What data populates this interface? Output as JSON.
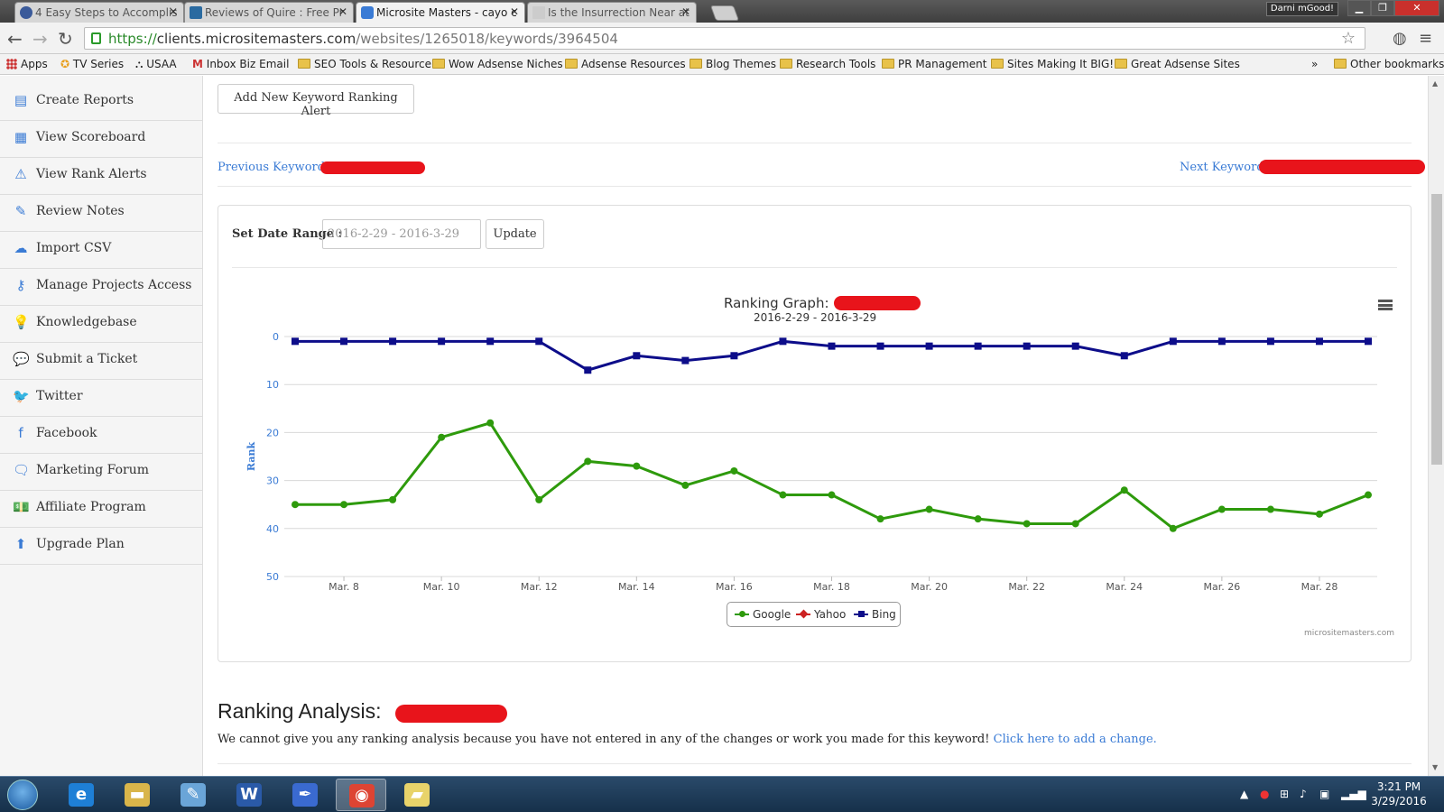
{
  "browser": {
    "tabs": [
      {
        "title": "4 Easy Steps to Accomplis",
        "active": false,
        "icon_color": "#3a5a9a"
      },
      {
        "title": "Reviews of Quire : Free Pr",
        "active": false,
        "icon_color": "#2a6aa0"
      },
      {
        "title": "Microsite Masters - cayo c",
        "active": true,
        "icon_color": "#3a7bd5"
      },
      {
        "title": "Is the Insurrection Near at",
        "active": false,
        "icon_color": "#999999"
      }
    ],
    "user": "Darni mGood!",
    "url": {
      "scheme": "https://",
      "host": "clients.micrositemasters.com",
      "path": "/websites/1265018/keywords/3964504"
    },
    "bookmarks": [
      {
        "label": "Apps",
        "type": "apps"
      },
      {
        "label": "TV Series",
        "type": "site"
      },
      {
        "label": "USAA",
        "type": "site"
      },
      {
        "label": "Inbox Biz Email",
        "type": "site"
      },
      {
        "label": "SEO Tools & Resource",
        "type": "folder"
      },
      {
        "label": "Wow Adsense Niches",
        "type": "folder"
      },
      {
        "label": "Adsense Resources",
        "type": "folder"
      },
      {
        "label": "Blog Themes",
        "type": "folder"
      },
      {
        "label": "Research Tools",
        "type": "folder"
      },
      {
        "label": "PR Management",
        "type": "folder"
      },
      {
        "label": "Sites Making It BIG!",
        "type": "folder"
      },
      {
        "label": "Great Adsense Sites",
        "type": "folder"
      },
      {
        "label": "»",
        "type": "more"
      },
      {
        "label": "Other bookmarks",
        "type": "folder"
      }
    ]
  },
  "sidebar": {
    "items": [
      {
        "label": "Create Reports",
        "icon": "document-icon",
        "glyph": "▤"
      },
      {
        "label": "View Scoreboard",
        "icon": "grid-icon",
        "glyph": "▦"
      },
      {
        "label": "View Rank Alerts",
        "icon": "warning-icon",
        "glyph": "⚠"
      },
      {
        "label": "Review Notes",
        "icon": "edit-icon",
        "glyph": "✎"
      },
      {
        "label": "Import CSV",
        "icon": "cloud-upload-icon",
        "glyph": "☁"
      },
      {
        "label": "Manage Projects Access",
        "icon": "key-icon",
        "glyph": "⚷"
      },
      {
        "label": "Knowledgebase",
        "icon": "lightbulb-icon",
        "glyph": "💡"
      },
      {
        "label": "Submit a Ticket",
        "icon": "chat-icon",
        "glyph": "💬"
      },
      {
        "label": "Twitter",
        "icon": "twitter-icon",
        "glyph": "🐦"
      },
      {
        "label": "Facebook",
        "icon": "facebook-icon",
        "glyph": "f"
      },
      {
        "label": "Marketing Forum",
        "icon": "comment-icon",
        "glyph": "🗨"
      },
      {
        "label": "Affiliate Program",
        "icon": "money-icon",
        "glyph": "💵"
      },
      {
        "label": "Upgrade Plan",
        "icon": "upload-icon",
        "glyph": "⬆"
      }
    ]
  },
  "main": {
    "add_alert_button": "Add New Keyword Ranking Alert",
    "previous_keyword": "Previous Keyword",
    "next_keyword": "Next Keyword",
    "date_range_label": "Set Date Range :",
    "date_range_value": "2016-2-29 - 2016-3-29",
    "update_button": "Update",
    "analysis_title": "Ranking Analysis:",
    "analysis_text": "We cannot give you any ranking analysis because you have not entered in any of the changes or work you made for this keyword!",
    "analysis_link": "Click here to add a change."
  },
  "chart_data": {
    "type": "line",
    "title": "Ranking Graph:",
    "subtitle": "2016-2-29 - 2016-3-29",
    "ylabel": "Rank",
    "xlabel": "",
    "y_reversed": true,
    "ylim": [
      0,
      50
    ],
    "yticks": [
      0,
      10,
      20,
      30,
      40,
      50
    ],
    "x": [
      "Mar. 7",
      "Mar. 8",
      "Mar. 9",
      "Mar. 10",
      "Mar. 11",
      "Mar. 12",
      "Mar. 13",
      "Mar. 14",
      "Mar. 15",
      "Mar. 16",
      "Mar. 17",
      "Mar. 18",
      "Mar. 19",
      "Mar. 20",
      "Mar. 21",
      "Mar. 22",
      "Mar. 23",
      "Mar. 24",
      "Mar. 25",
      "Mar. 26",
      "Mar. 27",
      "Mar. 28",
      "Mar. 29"
    ],
    "xtick_labels": [
      "Mar. 8",
      "Mar. 10",
      "Mar. 12",
      "Mar. 14",
      "Mar. 16",
      "Mar. 18",
      "Mar. 20",
      "Mar. 22",
      "Mar. 24",
      "Mar. 26",
      "Mar. 28"
    ],
    "series": [
      {
        "name": "Google",
        "color": "#2e9a0c",
        "marker": "circle",
        "values": [
          35,
          35,
          34,
          21,
          18,
          34,
          26,
          27,
          31,
          28,
          33,
          33,
          38,
          36,
          38,
          39,
          39,
          32,
          40,
          36,
          36,
          37,
          33
        ]
      },
      {
        "name": "Yahoo",
        "color": "#cc2222",
        "marker": "diamond",
        "values": []
      },
      {
        "name": "Bing",
        "color": "#0d0d8a",
        "marker": "square",
        "values": [
          1,
          1,
          1,
          1,
          1,
          1,
          7,
          4,
          5,
          4,
          1,
          2,
          2,
          2,
          2,
          2,
          2,
          4,
          1,
          1,
          1,
          1,
          1
        ]
      }
    ],
    "grid": true,
    "legend": "bottom-center",
    "credits": "micrositemasters.com"
  },
  "taskbar": {
    "apps": [
      {
        "name": "internet-explorer-icon",
        "glyph": "e",
        "color": "#1e7fd6"
      },
      {
        "name": "file-explorer-icon",
        "glyph": "▬",
        "color": "#d9b54a"
      },
      {
        "name": "paint-icon",
        "glyph": "✎",
        "color": "#6aa5d8"
      },
      {
        "name": "word-icon",
        "glyph": "W",
        "color": "#2a5aa8"
      },
      {
        "name": "pen-tool-icon",
        "glyph": "✒",
        "color": "#3a6ad0"
      },
      {
        "name": "chrome-icon",
        "glyph": "◉",
        "color": "#dd4433"
      },
      {
        "name": "notes-app-icon",
        "glyph": "▰",
        "color": "#e8d36a"
      }
    ],
    "time": "3:21 PM",
    "date": "3/29/2016"
  }
}
